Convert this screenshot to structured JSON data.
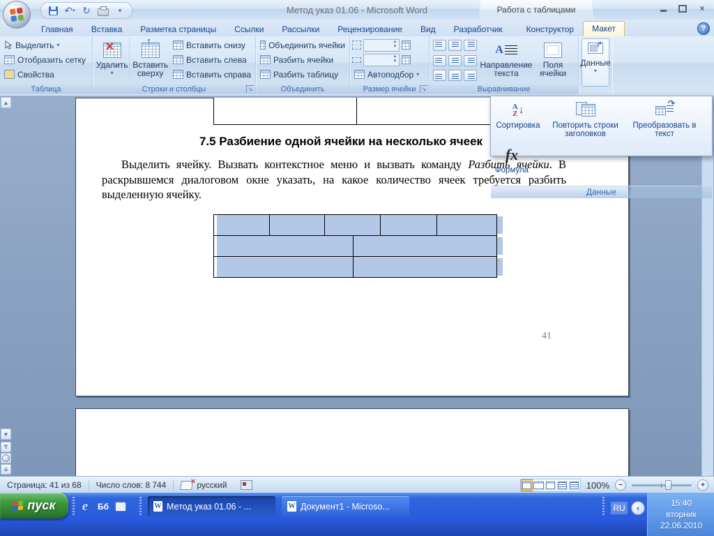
{
  "titlebar": {
    "title": "Метод указ 01.06 - Microsoft Word",
    "context_label": "Работа с таблицами"
  },
  "tabs": [
    "Главная",
    "Вставка",
    "Разметка страницы",
    "Ссылки",
    "Рассылки",
    "Рецензирование",
    "Вид",
    "Разработчик",
    "Конструктор",
    "Макет"
  ],
  "ribbon": {
    "table_group": {
      "label": "Таблица",
      "select": "Выделить",
      "view_gridlines": "Отобразить сетку",
      "properties": "Свойства"
    },
    "rows_group": {
      "label": "Строки и столбцы",
      "delete": "Удалить",
      "insert_above": "Вставить сверху",
      "insert_below": "Вставить снизу",
      "insert_left": "Вставить слева",
      "insert_right": "Вставить справа"
    },
    "merge_group": {
      "label": "Объединить",
      "merge_cells": "Объединить ячейки",
      "split_cells": "Разбить ячейки",
      "split_table": "Разбить таблицу"
    },
    "size_group": {
      "label": "Размер ячейки",
      "autofit": "Автоподбор"
    },
    "align_group": {
      "label": "Выравнивание",
      "text_direction": "Направление текста",
      "cell_margins": "Поля ячейки"
    },
    "data_group": {
      "label": "Данные"
    }
  },
  "flyout": {
    "sort": "Сортировка",
    "repeat_header": "Повторить строки заголовков",
    "convert": "Преобразовать в текст",
    "formula": "Формула",
    "label": "Данные"
  },
  "document": {
    "heading": "7.5 Разбиение одной ячейки на несколько ячеек",
    "para_start": "Выделить ячейку. Вызвать контекстное меню и вызвать команду ",
    "para_italic": "Разбить ячейки",
    "para_end": ". В раскрывшемся диалоговом окне указать, на какое количество ячеек требуется разбить выделенную ячейку.",
    "page_number": "41"
  },
  "status": {
    "page": "Страница: 41 из 68",
    "words": "Число слов: 8 744",
    "language": "русский",
    "zoom": "100%"
  },
  "taskbar": {
    "start": "пуск",
    "quick_launch_2": "Бб",
    "task1": "Метод указ 01.06 - ...",
    "task2": "Документ1 - Microso...",
    "lang": "RU",
    "time": "15:40",
    "weekday": "вторник",
    "date": "22.06.2010"
  },
  "colors": {
    "selection": "#b3c7e7",
    "active_tab": "#fdf5d7",
    "taskbar_blue": "#2a5ade",
    "start_green": "#3f9c3f",
    "ribbon_label": "#3e6aaa"
  }
}
